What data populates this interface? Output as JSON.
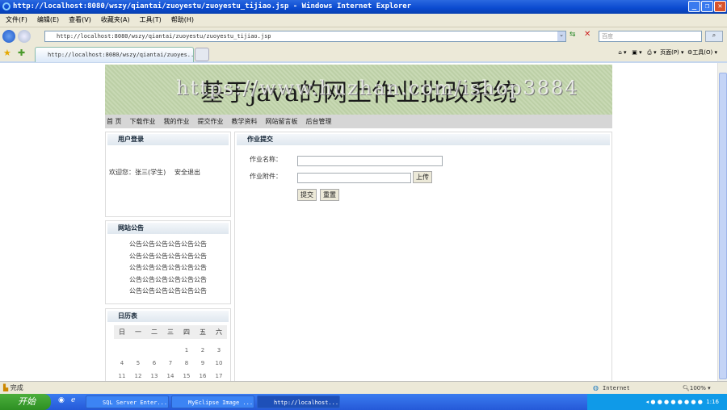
{
  "window": {
    "title": "http://localhost:8080/wszy/qiantai/zuoyestu/zuoyestu_tijiao.jsp - Windows Internet Explorer"
  },
  "menu": [
    "文件(F)",
    "编辑(E)",
    "查看(V)",
    "收藏夹(A)",
    "工具(T)",
    "帮助(H)"
  ],
  "address": "http://localhost:8080/wszy/qiantai/zuoyestu/zuoyestu_tijiao.jsp",
  "search_placeholder": "百度",
  "tab_label": "http://localhost:8080/wszy/qiantai/zuoyes...",
  "toolbar": {
    "page": "页面(P)",
    "tools": "工具(O)"
  },
  "site": {
    "title": "基于java的网上作业批改系统",
    "watermark": "https://www.huzhan.com/ishop3884",
    "nav": [
      "首 页",
      "下载作业",
      "我的作业",
      "提交作业",
      "教学资料",
      "网站留言板",
      "后台管理"
    ],
    "login": {
      "heading": "用户登录",
      "welcome": "欢迎您：张三(学生)",
      "logout": "安全退出"
    },
    "notice": {
      "heading": "网站公告",
      "items": [
        "公告公告公告公告公告公告",
        "公告公告公告公告公告公告",
        "公告公告公告公告公告公告",
        "公告公告公告公告公告公告",
        "公告公告公告公告公告公告"
      ]
    },
    "calendar": {
      "heading": "日历表",
      "weekdays": [
        "日",
        "一",
        "二",
        "三",
        "四",
        "五",
        "六"
      ],
      "rows": [
        [
          "",
          "",
          "",
          "",
          "1",
          "2",
          "3"
        ],
        [
          "4",
          "5",
          "6",
          "7",
          "8",
          "9",
          "10"
        ],
        [
          "11",
          "12",
          "13",
          "14",
          "15",
          "16",
          "17"
        ]
      ]
    },
    "form": {
      "heading": "作业提交",
      "name_label": "作业名称：",
      "name_value": "",
      "file_label": "作业附件：",
      "file_value": "",
      "upload": "上传",
      "submit": "提交",
      "reset": "重置"
    }
  },
  "status": {
    "text": "完成",
    "zone": "Internet",
    "zoom": "100%"
  },
  "taskbar": {
    "start": "开始",
    "tasks": [
      "SQL Server Enter...",
      "MyEclipse Image ...",
      "http://localhost..."
    ],
    "clock": "1:16"
  }
}
